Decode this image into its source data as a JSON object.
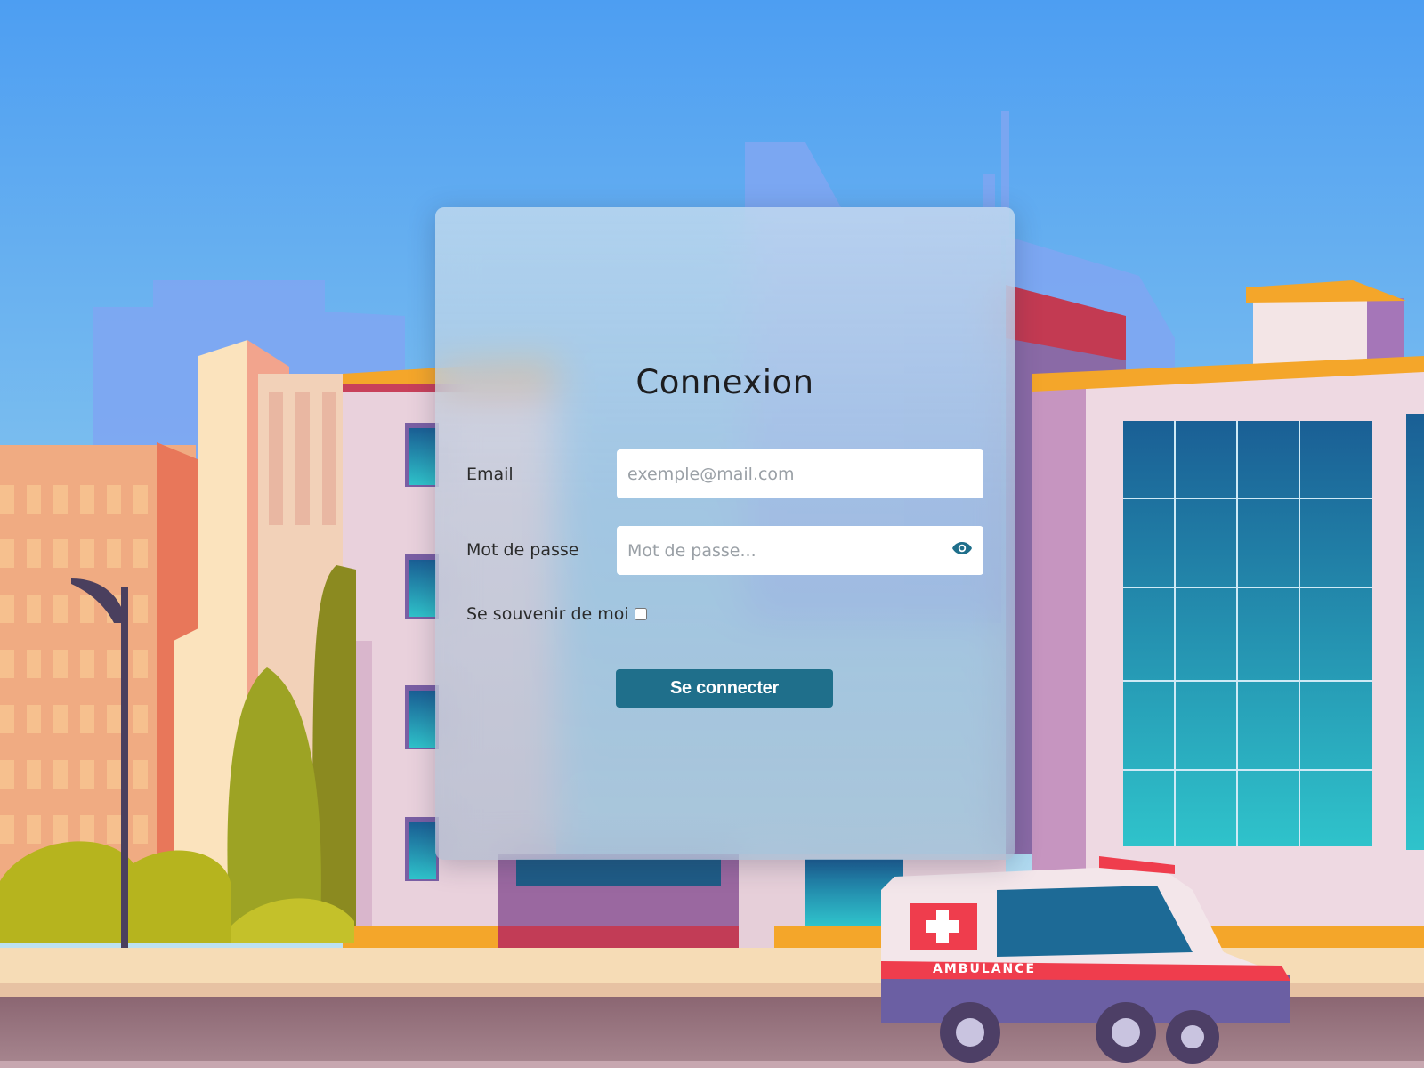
{
  "login": {
    "title": "Connexion",
    "email_label": "Email",
    "email_placeholder": "exemple@mail.com",
    "password_label": "Mot de passe",
    "password_placeholder": "Mot de passe...",
    "remember_label": "Se souvenir de moi",
    "remember_checked": false,
    "submit_label": "Se connecter"
  },
  "background": {
    "vehicle_text": "AMBULANCE",
    "scene": "hospital-street-illustration"
  },
  "colors": {
    "accent": "#1f6f8b",
    "sky_top": "#4d9ef2",
    "sky_bottom": "#b8e2f4"
  }
}
